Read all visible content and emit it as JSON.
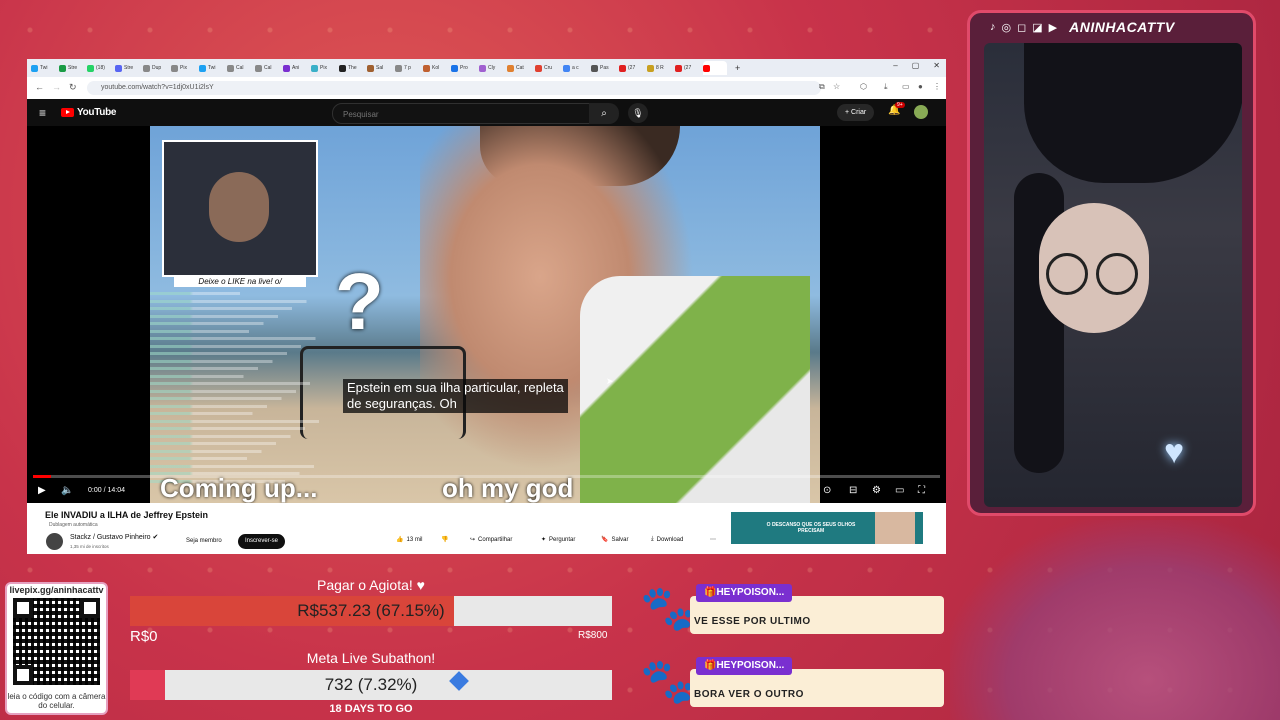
{
  "browser": {
    "url": "youtube.com/watch?v=1dj0xU1i2lsY",
    "tabs": [
      {
        "label": "Twi",
        "color": "#1da1f2"
      },
      {
        "label": "Stre",
        "color": "#1a9c45"
      },
      {
        "label": "(18)",
        "color": "#25d366"
      },
      {
        "label": "Stre",
        "color": "#5865f2"
      },
      {
        "label": "Dup",
        "color": "#888888"
      },
      {
        "label": "Pix",
        "color": "#888888"
      },
      {
        "label": "Twi",
        "color": "#1da1f2"
      },
      {
        "label": "Cal",
        "color": "#888888"
      },
      {
        "label": "Cal",
        "color": "#888888"
      },
      {
        "label": "Ani",
        "color": "#7a2fd0"
      },
      {
        "label": "Pix",
        "color": "#3ab0c8"
      },
      {
        "label": "The",
        "color": "#222222"
      },
      {
        "label": "Sal",
        "color": "#a06030"
      },
      {
        "label": "7 p",
        "color": "#888888"
      },
      {
        "label": "Kol",
        "color": "#c06030"
      },
      {
        "label": "Pro",
        "color": "#1a73e8"
      },
      {
        "label": "Cly",
        "color": "#a060d0"
      },
      {
        "label": "Cat",
        "color": "#e08030"
      },
      {
        "label": "Cru",
        "color": "#e04030"
      },
      {
        "label": "a c",
        "color": "#4285f4"
      },
      {
        "label": "Pas",
        "color": "#555555"
      },
      {
        "label": "(27",
        "color": "#e02020"
      },
      {
        "label": "8 R",
        "color": "#c8a020"
      },
      {
        "label": "(27",
        "color": "#e02020"
      },
      {
        "label": "",
        "color": "#ff0000"
      }
    ]
  },
  "youtube": {
    "logo_text": "YouTube",
    "search_placeholder": "Pesquisar",
    "create_label": "Criar",
    "notif_badge": "9+",
    "video": {
      "title": "Ele INVADIU a ILHA de Jeffrey Epstein",
      "dubbed_label": "Dublagem automática",
      "channel": "Stackz / Gustavo Pinheiro",
      "subscribers": "1,35 mi de inscritos",
      "join_label": "Seja membro",
      "subscribe_label": "Inscrever-se",
      "likes": "13 mil",
      "share_label": "Compartilhar",
      "ask_label": "Perguntar",
      "save_label": "Salvar",
      "download_label": "Download",
      "time_current": "0:00",
      "time_total": "14:04",
      "progress_fraction": 0.02,
      "subtitle_line1": "Epstein em sua ilha particular, repleta",
      "subtitle_line2": "de seguranças. Oh",
      "burned_caption_left": "Coming up...",
      "burned_caption_right": "oh my god",
      "like_banner": "Deixe o LIKE na live! o/",
      "question_mark": "?"
    },
    "ad_text": "O DESCANSO QUE OS SEUS OLHOS PRECISAM"
  },
  "stream": {
    "streamer_name": "ANINHACATTV",
    "qr_url": "livepix.gg/aninhacattv",
    "qr_hint": "leia o código com a câmera do celular.",
    "goal1": {
      "title": "Pagar o Agiota! ♥",
      "value_text": "R$537.23 (67.15%)",
      "fraction": 0.6715,
      "min": "R$0",
      "max": "R$800",
      "color": "#d9453a"
    },
    "goal2": {
      "title": "Meta Live Subathon!",
      "value_text": "732 (7.32%)",
      "fraction": 0.0732,
      "footer": "18 DAYS TO GO",
      "color": "#e03a55"
    },
    "alerts": [
      {
        "name": "🎁HEYPOISON...",
        "message": "VE ESSE POR ULTIMO"
      },
      {
        "name": "🎁HEYPOISON...",
        "message": "BORA VER O OUTRO"
      }
    ]
  }
}
